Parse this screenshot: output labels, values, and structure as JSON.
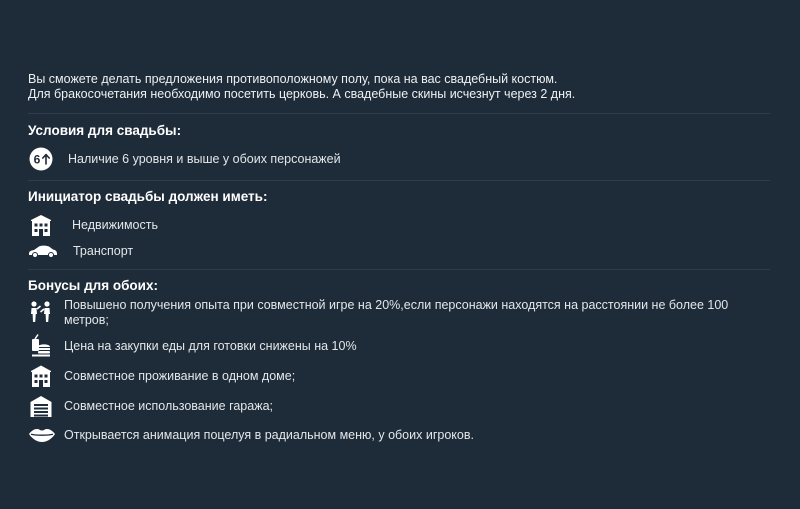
{
  "intro": {
    "line1": "Вы сможете делать предложения противоположному полу, пока на вас свадебный костюм.",
    "line2": "Для бракосочетания необходимо посетить церковь. А свадебные скины исчезнут через 2 дня."
  },
  "conditions": {
    "title": "Условия для свадьбы:",
    "items": [
      {
        "icon": "level-up-icon",
        "badge": "6",
        "text": "Наличие 6 уровня и выше у обоих персонажей"
      }
    ]
  },
  "initiator": {
    "title": "Инициатор свадьбы должен иметь:",
    "items": [
      {
        "icon": "building-icon",
        "text": "Недвижимость"
      },
      {
        "icon": "car-icon",
        "text": "Транспорт"
      }
    ]
  },
  "bonuses": {
    "title": "Бонусы для обоих:",
    "items": [
      {
        "icon": "two-people-icon",
        "text": "Повышено получения опыта при совместной игре на 20%,если персонажи находятся на расстоянии не более 100 метров;"
      },
      {
        "icon": "food-icon",
        "text": "Цена на закупки еды для готовки снижены на 10%"
      },
      {
        "icon": "house-icon",
        "text": "Совместное проживание в одном доме;"
      },
      {
        "icon": "garage-icon",
        "text": "Совместное использование гаража;"
      },
      {
        "icon": "lips-icon",
        "text": "Открывается анимация поцелуя в радиальном меню, у обоих игроков."
      }
    ]
  },
  "colors": {
    "background": "#1e2b38",
    "text": "#e6e9ec",
    "divider": "#2f3d4b"
  }
}
